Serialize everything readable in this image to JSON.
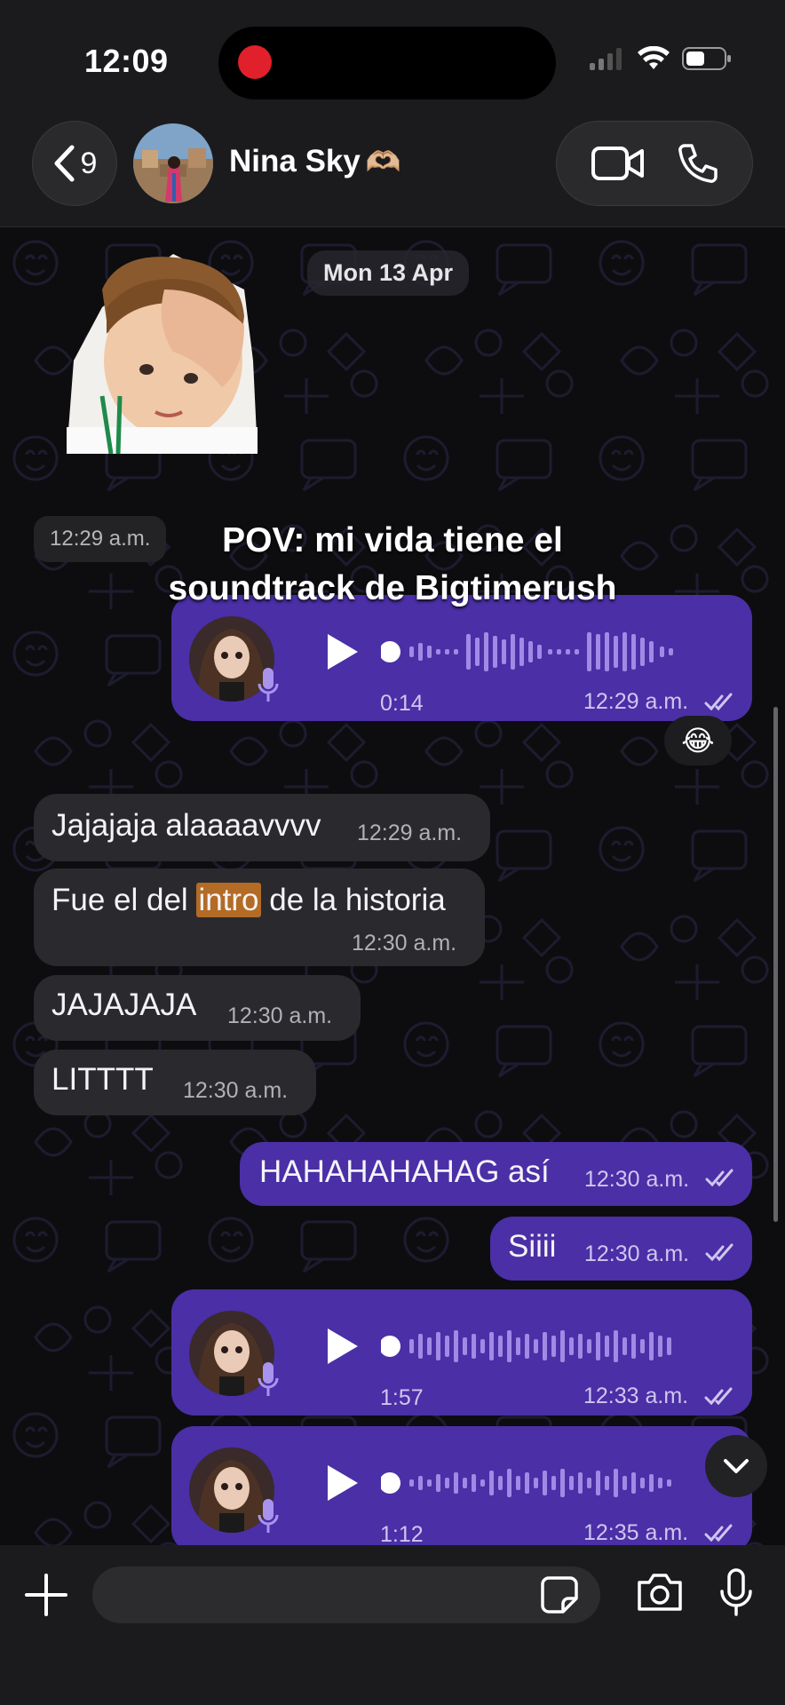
{
  "status_bar": {
    "time": "12:09"
  },
  "header": {
    "back_count": "9",
    "contact_name": "Nina Sky",
    "name_emoji": "🫶🏼"
  },
  "chat": {
    "date": "Mon 13 Apr",
    "sticker_time": "12:29 a.m.",
    "overlay_caption": [
      "POV: mi vida tiene el",
      "soundtrack de Bigtimerush"
    ],
    "messages": [
      {
        "kind": "voice",
        "dir": "out",
        "duration": "0:14",
        "time": "12:29 a.m.",
        "reaction": "😂"
      },
      {
        "kind": "text",
        "dir": "in",
        "text": "Jajajaja alaaaavvvv",
        "time": "12:29 a.m."
      },
      {
        "kind": "text",
        "dir": "in",
        "text_before": "Fue el del ",
        "text_highlight": "intro",
        "text_after": " de la historia",
        "time": "12:30 a.m."
      },
      {
        "kind": "text",
        "dir": "in",
        "text": "JAJAJAJA",
        "time": "12:30 a.m."
      },
      {
        "kind": "text",
        "dir": "in",
        "text": "LITTTT",
        "time": "12:30 a.m."
      },
      {
        "kind": "text",
        "dir": "out",
        "text": "HAHAHAHAHAG así",
        "time": "12:30 a.m."
      },
      {
        "kind": "text",
        "dir": "out",
        "text": "Siiii",
        "time": "12:30 a.m."
      },
      {
        "kind": "voice",
        "dir": "out",
        "duration": "1:57",
        "time": "12:33 a.m."
      },
      {
        "kind": "voice",
        "dir": "out",
        "duration": "1:12",
        "time": "12:35 a.m."
      }
    ]
  },
  "composer": {
    "placeholder": ""
  },
  "colors": {
    "outgoing": "#4a2fa6",
    "incoming": "#2a2a2e",
    "highlight": "#b36b26",
    "record": "#e0202a"
  },
  "icons": [
    "back-chevron-icon",
    "video-call-icon",
    "phone-icon",
    "play-icon",
    "mic-icon",
    "double-check-icon",
    "chevron-down-icon",
    "plus-icon",
    "sticker-icon",
    "camera-icon"
  ]
}
